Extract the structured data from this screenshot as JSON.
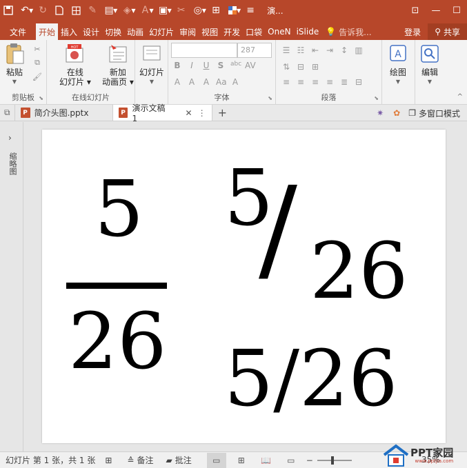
{
  "window": {
    "title": "演..."
  },
  "ribbon_tabs": [
    {
      "label": "文件"
    },
    {
      "label": "开始"
    },
    {
      "label": "插入"
    },
    {
      "label": "设计"
    },
    {
      "label": "切换"
    },
    {
      "label": "动画"
    },
    {
      "label": "幻灯片"
    },
    {
      "label": "审阅"
    },
    {
      "label": "视图"
    },
    {
      "label": "开发"
    },
    {
      "label": "口袋"
    },
    {
      "label": "OneN"
    },
    {
      "label": "iSlide"
    }
  ],
  "tell_me": "告诉我...",
  "account": {
    "login": "登录",
    "share": "共享"
  },
  "groups": {
    "clipboard": {
      "label": "剪贴板",
      "paste": "粘贴"
    },
    "online_slides": {
      "label": "在线幻灯片",
      "online": "在线\n幻灯片",
      "new_anim": "新加\n动画页",
      "hot_badge": "HOT"
    },
    "slides": {
      "slide": "幻灯片"
    },
    "font": {
      "label": "字体",
      "font_size": "287"
    },
    "paragraph": {
      "label": "段落"
    },
    "drawing": {
      "draw": "绘图"
    },
    "editing": {
      "edit": "编辑"
    }
  },
  "doc_tabs": [
    {
      "label": "简介头图.pptx",
      "active": false
    },
    {
      "label": "演示文稿1",
      "active": true
    }
  ],
  "multi_window": "多窗口模式",
  "left_pane_label": "缩略图",
  "slide": {
    "stacked_numerator": "5",
    "stacked_denominator": "26",
    "slanted_numerator": "5",
    "slanted_slash": "/",
    "slanted_denominator": "26",
    "inline_fraction": "5/26"
  },
  "status": {
    "slide_info": "幻灯片 第 1 张，共 1 张",
    "notes": "备注",
    "comments": "批注",
    "zoom": "35%"
  },
  "watermark": {
    "text": "PPT家园",
    "sub": "www.pptjia.com"
  }
}
